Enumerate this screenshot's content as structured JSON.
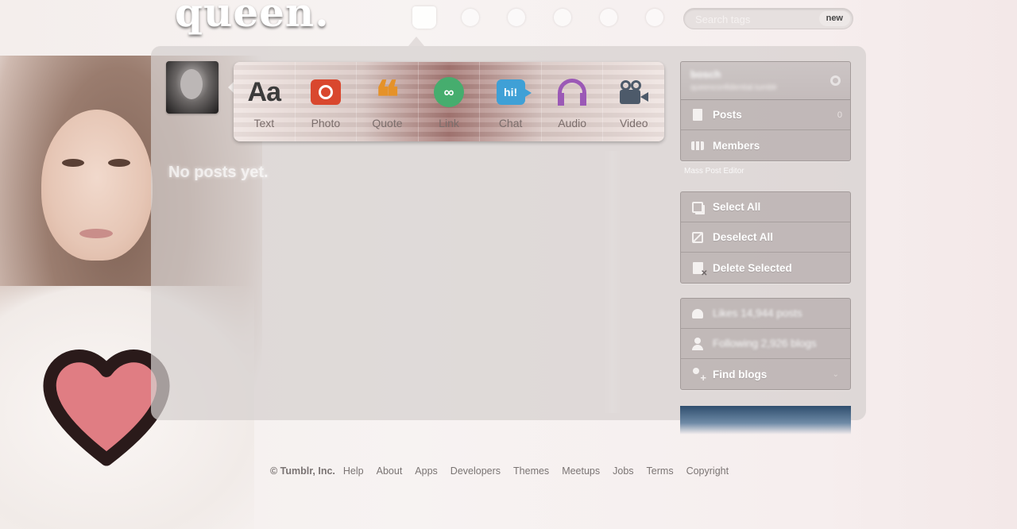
{
  "header": {
    "logo": "queen.",
    "nav_icons": [
      "home-icon",
      "inbox-icon",
      "explore-icon",
      "activity-icon",
      "account-icon",
      "power-icon"
    ],
    "search": {
      "placeholder": "Search tags",
      "badge": "new"
    }
  },
  "composer": {
    "post_types": [
      {
        "label": "Text",
        "icon": "text-icon",
        "glyph": "Aa",
        "color": "#3b3b3b"
      },
      {
        "label": "Photo",
        "icon": "photo-icon",
        "color": "#d9472e"
      },
      {
        "label": "Quote",
        "icon": "quote-icon",
        "glyph": "❝",
        "color": "#e59229"
      },
      {
        "label": "Link",
        "icon": "link-icon",
        "glyph": "∞",
        "color": "#46ad6e"
      },
      {
        "label": "Chat",
        "icon": "chat-icon",
        "glyph": "hi!",
        "color": "#3fa0d6"
      },
      {
        "label": "Audio",
        "icon": "audio-icon",
        "color": "#9b59b6"
      },
      {
        "label": "Video",
        "icon": "video-icon",
        "color": "#4d5a6a"
      }
    ]
  },
  "main": {
    "empty_message": "No posts yet."
  },
  "sidebar": {
    "blog": {
      "name": "bosch",
      "url": "queenconfidential.tumblr"
    },
    "blog_items": [
      {
        "label": "Posts",
        "count": "0",
        "icon": "document-icon"
      },
      {
        "label": "Members",
        "icon": "members-icon"
      }
    ],
    "mass_post_editor": "Mass Post Editor",
    "editor_items": [
      {
        "label": "Select All",
        "icon": "select-all-icon"
      },
      {
        "label": "Deselect All",
        "icon": "deselect-all-icon"
      },
      {
        "label": "Delete Selected",
        "icon": "delete-selected-icon"
      }
    ],
    "account_items": [
      {
        "label": "Likes 14,944 posts",
        "icon": "heart-icon"
      },
      {
        "label": "Following 2,926 blogs",
        "icon": "person-icon"
      },
      {
        "label": "Find blogs",
        "icon": "find-blogs-icon"
      }
    ]
  },
  "footer": {
    "copyright": "© Tumblr, Inc.",
    "links": [
      "Help",
      "About",
      "Apps",
      "Developers",
      "Themes",
      "Meetups",
      "Jobs",
      "Terms",
      "Copyright"
    ]
  }
}
